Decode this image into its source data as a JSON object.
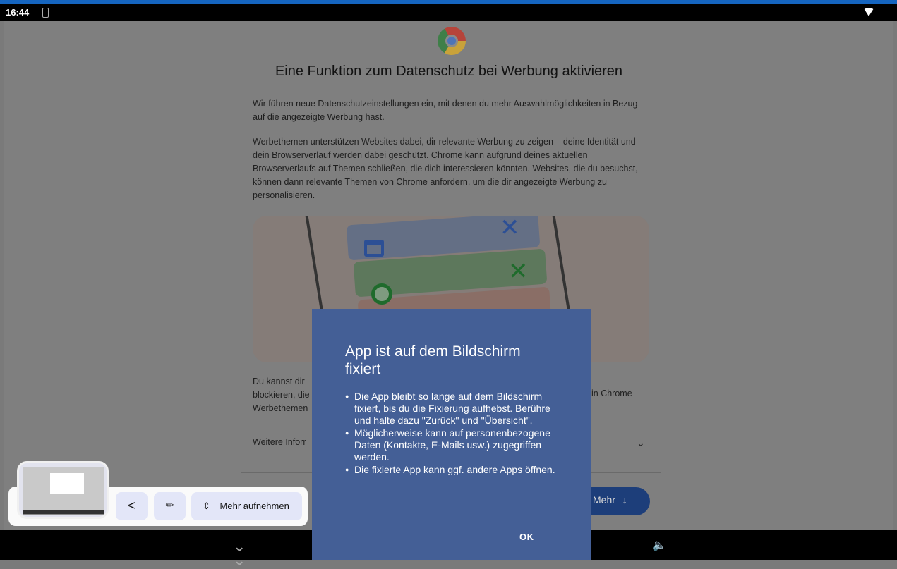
{
  "status_bar": {
    "time": "16:44"
  },
  "page": {
    "title": "Eine Funktion zum Datenschutz bei Werbung aktivieren",
    "paragraph1": "Wir führen neue Datenschutzeinstellungen ein, mit denen du mehr Auswahlmöglichkeiten in Bezug auf die angezeigte Werbung hast.",
    "paragraph2": "Werbethemen unterstützen Websites dabei, dir relevante Werbung zu zeigen – deine Identität und dein Browserverlauf werden dabei geschützt. Chrome kann aufgrund deines aktuellen Browserverlaufs auf Themen schließen, die dich interessieren könnten. Websites, die du besuchst, können dann relevante Themen von Chrome anfordern, um die dir angezeigte Werbung zu personalisieren.",
    "paragraph3_visible": "Du kannst dir\nblockieren, die\nWerbethemen",
    "paragraph3_right_fragment": "in Chrome",
    "more_info_label": "Weitere Inforr",
    "more_button_label": "Mehr",
    "more_button_icon": "arrow-down-icon"
  },
  "dialog": {
    "title": "App ist auf dem Bildschirm fixiert",
    "bullets": [
      "Die App bleibt so lange auf dem Bildschirm fixiert, bis du die Fixierung aufhebst. Berühre und halte dazu \"Zurück\" und \"Übersicht\".",
      "Möglicherweise kann auf personenbezogene Daten (Kontakte, E-Mails usw.) zugegriffen werden.",
      "Die fixierte App kann ggf. andere Apps öffnen."
    ],
    "ok_label": "OK"
  },
  "screenshot_toolbar": {
    "share_icon": "share-icon",
    "edit_icon": "pencil-icon",
    "expand_icon": "expand-vertical-icon",
    "capture_more_label": "Mehr aufnehmen"
  },
  "colors": {
    "dialog_bg": "#445f96",
    "accent_stripe": "#1565c0",
    "primary_button": "#1d3e7a"
  }
}
